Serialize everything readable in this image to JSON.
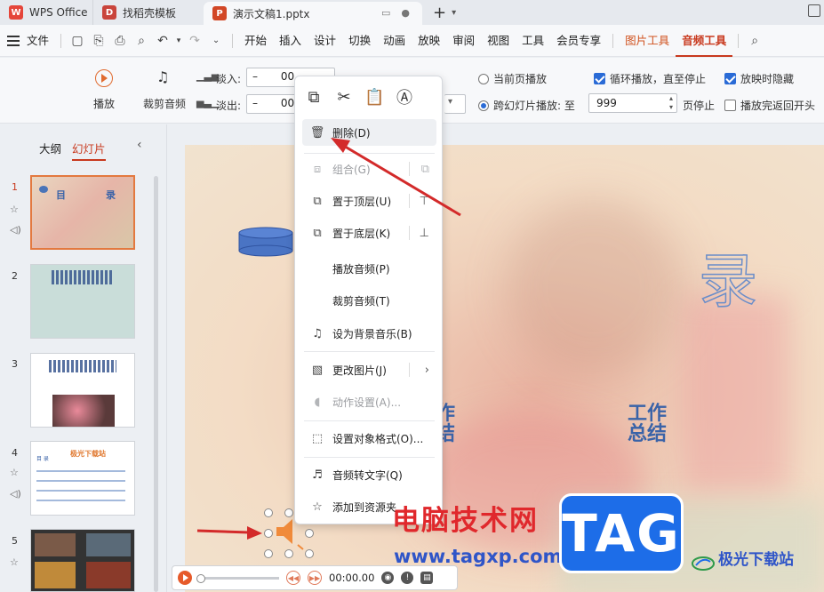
{
  "tabs": {
    "wps": "WPS Office",
    "find": "找稻壳模板",
    "doc": "演示文稿1.pptx"
  },
  "menu": {
    "file": "文件",
    "items": [
      "开始",
      "插入",
      "设计",
      "切换",
      "动画",
      "放映",
      "审阅",
      "视图",
      "工具",
      "会员专享"
    ],
    "picture_tools": "图片工具",
    "audio_tools": "音频工具"
  },
  "ribbon": {
    "play": "播放",
    "trim": "裁剪音频",
    "fade_in_label": "淡入:",
    "fade_in_value": "00.",
    "fade_out_label": "淡出:",
    "fade_out_value": "00.",
    "radio_current": "当前页播放",
    "radio_cross": "跨幻灯片播放: 至",
    "page_value": "999",
    "page_stop": "页停止",
    "loop": "循环播放，直至停止",
    "hide": "放映时隐藏",
    "rewind": "播放完返回开头"
  },
  "panel": {
    "tab_outline": "大纲",
    "tab_slides": "幻灯片",
    "slide_numbers": [
      "1",
      "2",
      "3",
      "4",
      "5"
    ],
    "thumb1": {
      "t1": "目",
      "t2": "录"
    },
    "thumb4": {
      "title": "极光下载站",
      "heading": "目 录"
    }
  },
  "slide": {
    "big_char": "录",
    "summary_left": "作\n结",
    "summary_right": "工作\n总结"
  },
  "audiobar": {
    "time": "00:00.00"
  },
  "context_menu": {
    "delete": "删除(D)",
    "group": "组合(G)",
    "bring_front": "置于顶层(U)",
    "send_back": "置于底层(K)",
    "play_audio": "播放音频(P)",
    "trim_audio": "裁剪音频(T)",
    "set_bg_music": "设为背景音乐(B)",
    "change_picture": "更改图片(J)",
    "action_settings": "动作设置(A)...",
    "format_object": "设置对象格式(O)...",
    "audio_to_text": "音频转文字(Q)",
    "add_to_resources": "添加到资源夹"
  },
  "watermark": {
    "site_cn": "电脑技术网",
    "site_url": "www.tagxp.com",
    "tag": "TAG",
    "jg": "极光下载站"
  },
  "colors": {
    "accent": "#c8391e",
    "arrow": "#d32a2a",
    "link_blue": "#2a6bd6"
  }
}
